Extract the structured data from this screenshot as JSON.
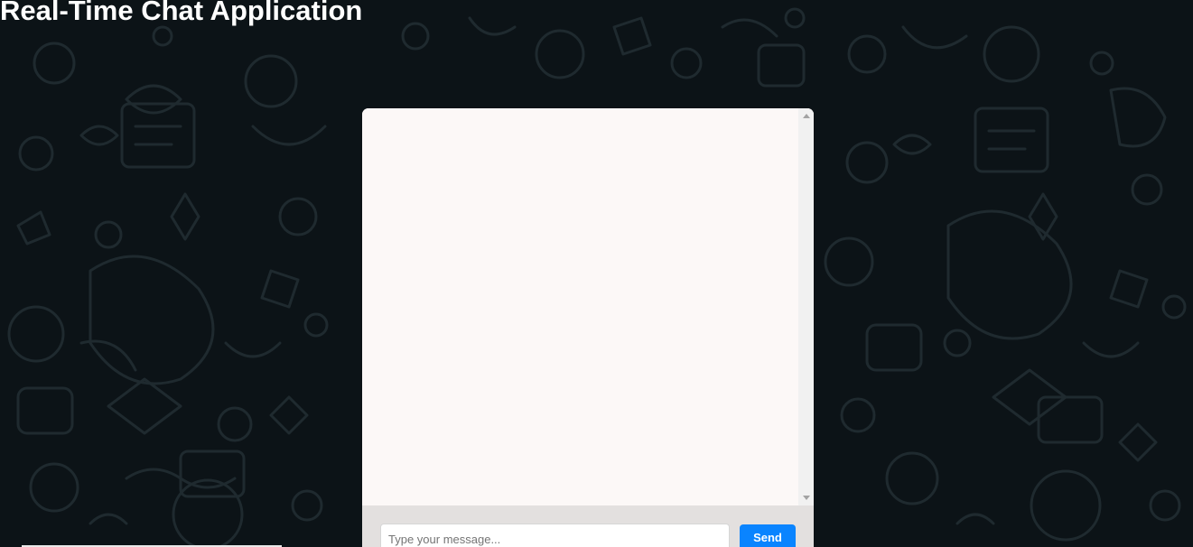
{
  "header": {
    "title": "Real-Time Chat Application"
  },
  "chat": {
    "messages": [],
    "input": {
      "value": "",
      "placeholder": "Type your message..."
    },
    "send_label": "Send"
  },
  "colors": {
    "page_background": "#0c1317",
    "doodle_stroke": "#1f2a2f",
    "chat_background": "#fcf8f7",
    "input_bar_background": "#e3e0df",
    "send_button": "#0a84ff",
    "title_text": "#ffffff"
  },
  "icons": {
    "scroll_up": "triangle-up",
    "scroll_down": "triangle-down"
  }
}
